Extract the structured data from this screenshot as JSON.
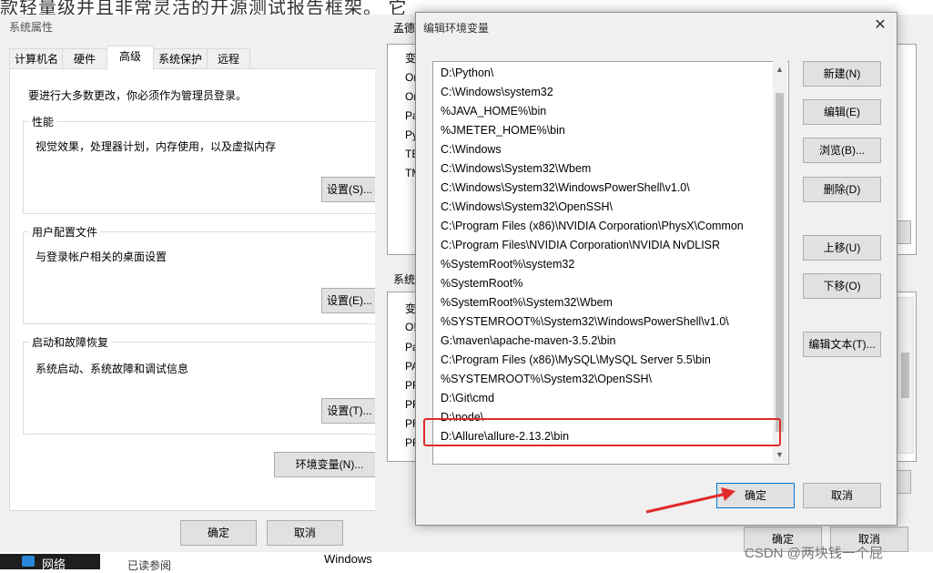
{
  "background": {
    "article_text": "款轻量级并且非常灵活的开源测试报告框架。 它",
    "taskbar_network": "网络",
    "taskbar_text": "已读参阅",
    "windows_label": "Windows"
  },
  "system_properties": {
    "title": "系统属性",
    "tabs": [
      "计算机名",
      "硬件",
      "高级",
      "系统保护",
      "远程"
    ],
    "admin_note": "要进行大多数更改，你必须作为管理员登录。",
    "performance": {
      "title": "性能",
      "text": "视觉效果，处理器计划，内存使用，以及虚拟内存",
      "button": "设置(S)..."
    },
    "user_profiles": {
      "title": "用户配置文件",
      "text": "与登录帐户相关的桌面设置",
      "button": "设置(E)..."
    },
    "startup_recovery": {
      "title": "启动和故障恢复",
      "text": "系统启动、系统故障和调试信息",
      "button": "设置(T)..."
    },
    "env_vars_button": "环境变量(N)...",
    "ok": "确定",
    "cancel": "取消"
  },
  "env_variables_dialog": {
    "user_section_label": "孟德",
    "user_col_header": "变",
    "user_rows": [
      "On",
      "On",
      "Pa",
      "Py",
      "TE",
      "TM"
    ],
    "system_section_label": "系统",
    "system_col_header": "变",
    "system_rows": [
      "O!",
      "Pa",
      "PA",
      "PR",
      "PR",
      "PR",
      "PR"
    ],
    "ok": "确定",
    "cancel": "取消"
  },
  "edit_env_dialog": {
    "title": "编辑环境变量",
    "paths": [
      "D:\\Python\\",
      "C:\\Windows\\system32",
      "%JAVA_HOME%\\bin",
      "%JMETER_HOME%\\bin",
      "C:\\Windows",
      "C:\\Windows\\System32\\Wbem",
      "C:\\Windows\\System32\\WindowsPowerShell\\v1.0\\",
      "C:\\Windows\\System32\\OpenSSH\\",
      "C:\\Program Files (x86)\\NVIDIA Corporation\\PhysX\\Common",
      "C:\\Program Files\\NVIDIA Corporation\\NVIDIA NvDLISR",
      "%SystemRoot%\\system32",
      "%SystemRoot%",
      "%SystemRoot%\\System32\\Wbem",
      "%SYSTEMROOT%\\System32\\WindowsPowerShell\\v1.0\\",
      "G:\\maven\\apache-maven-3.5.2\\bin",
      "C:\\Program Files (x86)\\MySQL\\MySQL Server 5.5\\bin",
      "%SYSTEMROOT%\\System32\\OpenSSH\\",
      "D:\\Git\\cmd",
      "D:\\node\\",
      "D:\\Allure\\allure-2.13.2\\bin"
    ],
    "buttons": {
      "new": "新建(N)",
      "edit": "编辑(E)",
      "browse": "浏览(B)...",
      "delete": "删除(D)",
      "move_up": "上移(U)",
      "move_down": "下移(O)",
      "edit_text": "编辑文本(T)...",
      "ok": "确定",
      "cancel": "取消"
    }
  },
  "watermark": "CSDN @两块钱一个屁",
  "colors": {
    "highlight": "#e22a2a",
    "arrow": "#e22a2a"
  }
}
